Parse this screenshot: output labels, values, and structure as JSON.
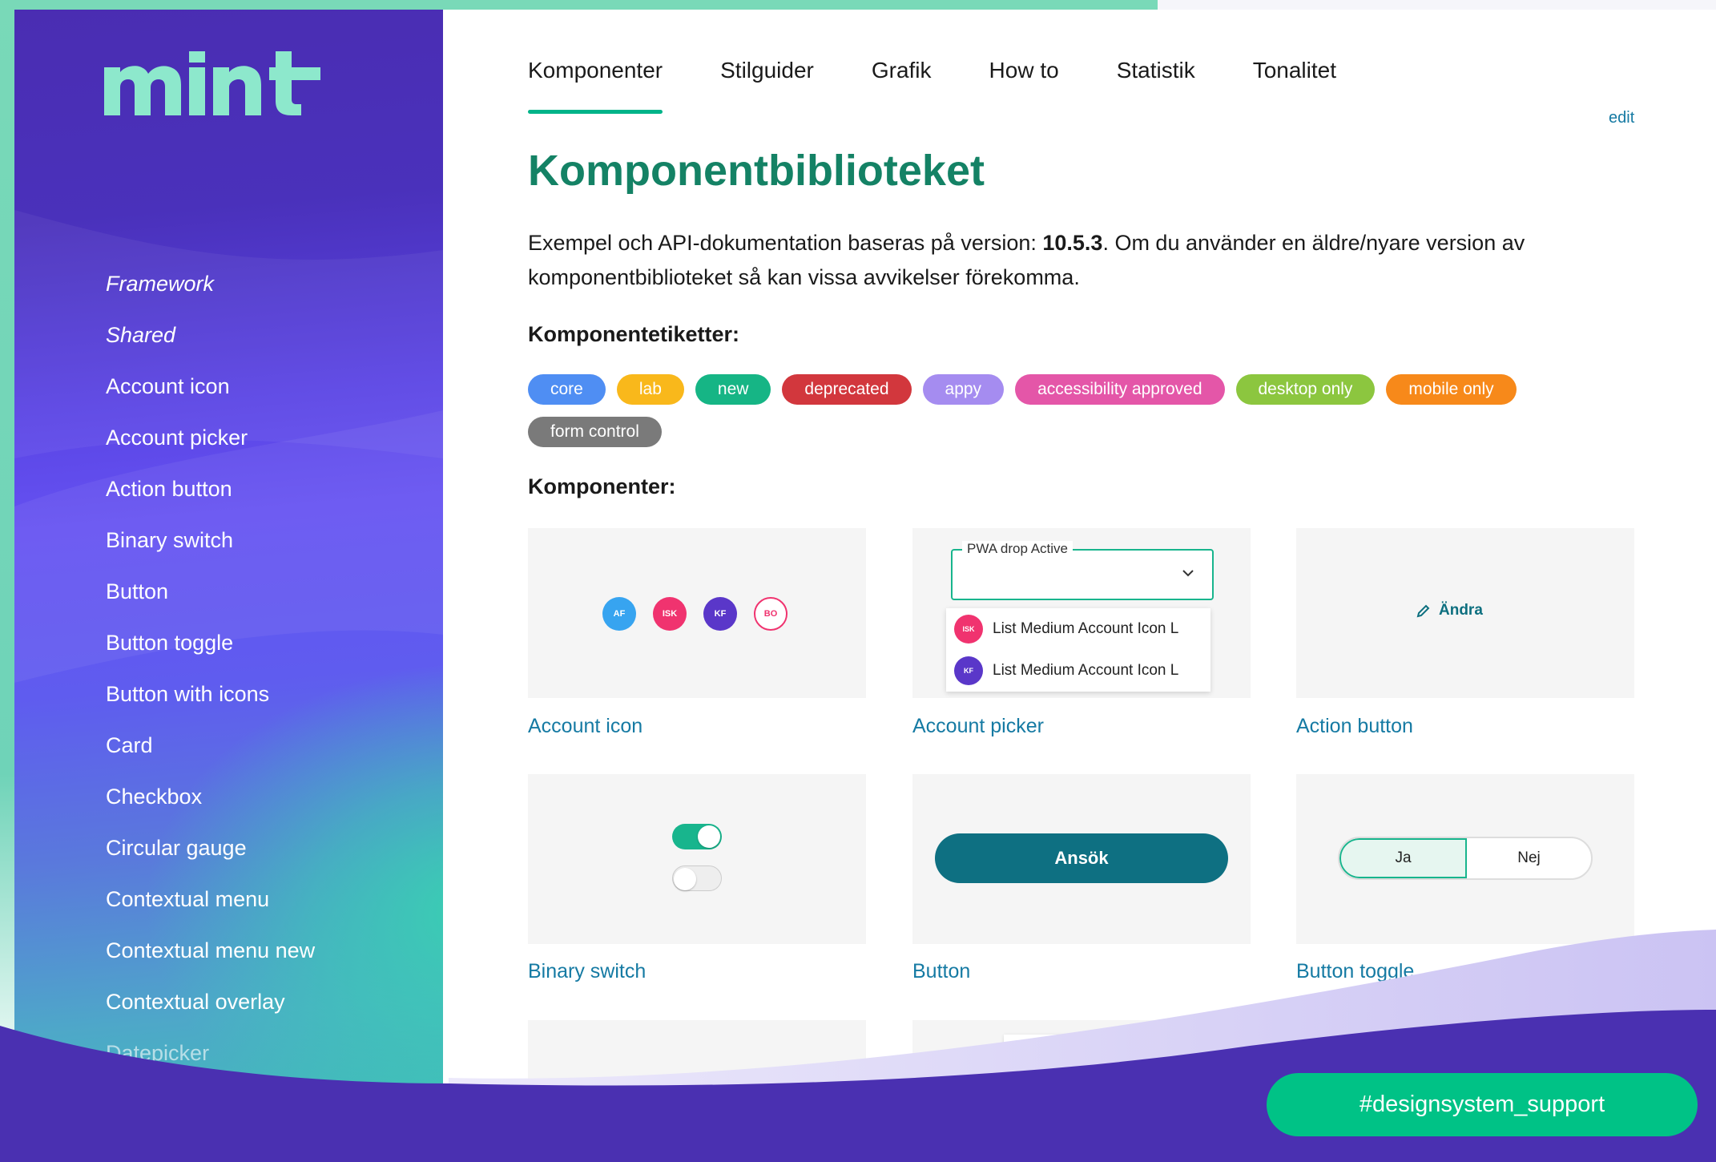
{
  "logo": {
    "text": "mint",
    "color": "#8de8cc"
  },
  "sidebar": {
    "items": [
      {
        "label": "Framework",
        "style": "group"
      },
      {
        "label": "Shared",
        "style": "group"
      },
      {
        "label": "Account icon"
      },
      {
        "label": "Account picker"
      },
      {
        "label": "Action button"
      },
      {
        "label": "Binary switch"
      },
      {
        "label": "Button"
      },
      {
        "label": "Button toggle"
      },
      {
        "label": "Button with icons"
      },
      {
        "label": "Card"
      },
      {
        "label": "Checkbox"
      },
      {
        "label": "Circular gauge"
      },
      {
        "label": "Contextual menu"
      },
      {
        "label": "Contextual menu new"
      },
      {
        "label": "Contextual overlay"
      },
      {
        "label": "Datepicker"
      }
    ]
  },
  "tabs": [
    {
      "label": "Komponenter",
      "active": true
    },
    {
      "label": "Stilguider"
    },
    {
      "label": "Grafik"
    },
    {
      "label": "How to"
    },
    {
      "label": "Statistik"
    },
    {
      "label": "Tonalitet"
    }
  ],
  "edit_link": "edit",
  "page_title": "Komponentbiblioteket",
  "intro": {
    "before": "Exempel och API-dokumentation baseras på version: ",
    "version": "10.5.3",
    "after": ". Om du använder en äldre/nyare version av komponentbiblioteket så kan vissa avvikelser förekomma."
  },
  "labels_heading": "Komponentetiketter:",
  "chips": [
    {
      "label": "core",
      "color": "#4f8ef3"
    },
    {
      "label": "lab",
      "color": "#f9b81b"
    },
    {
      "label": "new",
      "color": "#16b585"
    },
    {
      "label": "deprecated",
      "color": "#d2373d"
    },
    {
      "label": "appy",
      "color": "#a58cf0"
    },
    {
      "label": "accessibility approved",
      "color": "#e456a8"
    },
    {
      "label": "desktop only",
      "color": "#8cc63f"
    },
    {
      "label": "mobile only",
      "color": "#f7891a"
    },
    {
      "label": "form control",
      "color": "#7a7a7a"
    }
  ],
  "components_heading": "Komponenter:",
  "cards": {
    "account_icon": {
      "label": "Account icon",
      "avatars": [
        {
          "text": "AF",
          "color": "#37a4f0"
        },
        {
          "text": "ISK",
          "color": "#f0336f"
        },
        {
          "text": "KF",
          "color": "#5a37c9"
        },
        {
          "text": "BO",
          "color": "#ffffff",
          "outline": "#f0336f"
        }
      ]
    },
    "account_picker": {
      "label": "Account picker",
      "field_label": "PWA drop Active",
      "items": [
        {
          "avatar": "ISK",
          "color": "#f0336f",
          "text": "List Medium Account Icon L"
        },
        {
          "avatar": "KF",
          "color": "#5a37c9",
          "text": "List Medium Account Icon L"
        }
      ]
    },
    "action_button": {
      "label": "Action button",
      "demo_text": "Ändra"
    },
    "binary_switch": {
      "label": "Binary switch",
      "on_color": "#18b58d"
    },
    "button": {
      "label": "Button",
      "demo_text": "Ansök"
    },
    "button_toggle": {
      "label": "Button toggle",
      "options": [
        "Ja",
        "Nej"
      ]
    }
  },
  "support_button": "#designsystem_support"
}
